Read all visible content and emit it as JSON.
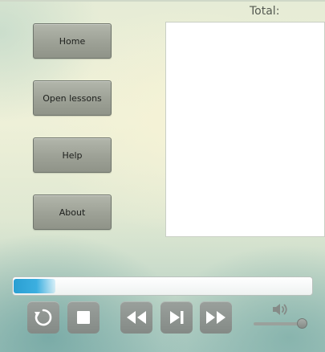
{
  "nav": {
    "home_label": "Home",
    "open_lessons_label": "Open lessons",
    "help_label": "Help",
    "about_label": "About"
  },
  "total": {
    "label": "Total:"
  },
  "progress": {
    "fraction": 0.14,
    "fill_color": "#2a9fd2"
  },
  "controls": {
    "replay_icon": "replay-icon",
    "stop_icon": "stop-icon",
    "rewind_icon": "rewind-icon",
    "next_icon": "skip-next-icon",
    "fast_forward_icon": "fast-forward-icon"
  },
  "volume": {
    "icon": "speaker-icon",
    "level": 0.95
  }
}
